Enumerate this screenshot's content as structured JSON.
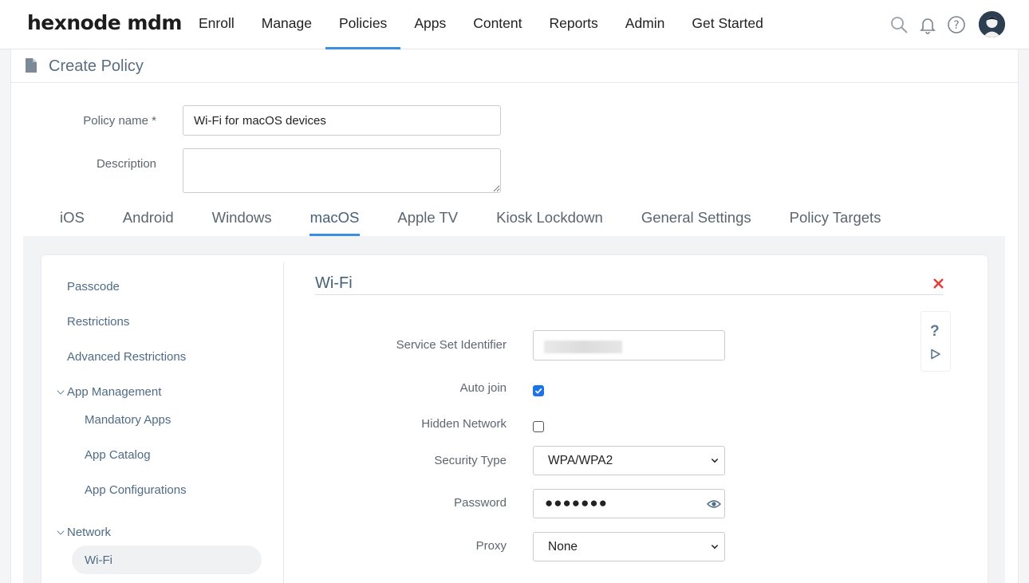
{
  "app": {
    "logo": "hexnode mdm"
  },
  "nav": {
    "items": [
      "Enroll",
      "Manage",
      "Policies",
      "Apps",
      "Content",
      "Reports",
      "Admin",
      "Get Started"
    ],
    "active": "Policies"
  },
  "header_icons": [
    "search-icon",
    "bell-icon",
    "help-icon",
    "avatar"
  ],
  "page": {
    "title": "Create Policy"
  },
  "form": {
    "policy_name_label": "Policy name *",
    "policy_name_value": "Wi-Fi for macOS devices",
    "description_label": "Description",
    "description_value": ""
  },
  "tabs": {
    "items": [
      "iOS",
      "Android",
      "Windows",
      "macOS",
      "Apple TV",
      "Kiosk Lockdown",
      "General Settings",
      "Policy Targets"
    ],
    "active": "macOS"
  },
  "sidebar": {
    "items": [
      "Passcode",
      "Restrictions",
      "Advanced Restrictions"
    ],
    "app_management": {
      "label": "App Management",
      "children": [
        "Mandatory Apps",
        "App Catalog",
        "App Configurations"
      ]
    },
    "network": {
      "label": "Network",
      "children": [
        "Wi-Fi"
      ],
      "active": "Wi-Fi"
    }
  },
  "section": {
    "title": "Wi-Fi",
    "fields": {
      "ssid_label": "Service Set Identifier",
      "auto_join_label": "Auto join",
      "auto_join_checked": true,
      "hidden_network_label": "Hidden Network",
      "hidden_network_checked": false,
      "security_type_label": "Security Type",
      "security_type_value": "WPA/WPA2",
      "password_label": "Password",
      "password_masked": "●●●●●●●",
      "proxy_label": "Proxy",
      "proxy_value": "None"
    },
    "helper": {
      "help_glyph": "?"
    }
  },
  "colors": {
    "accent": "#3a8ee6",
    "link": "#4f6b86",
    "checkbox": "#1a73e8",
    "close": "#e53935"
  }
}
